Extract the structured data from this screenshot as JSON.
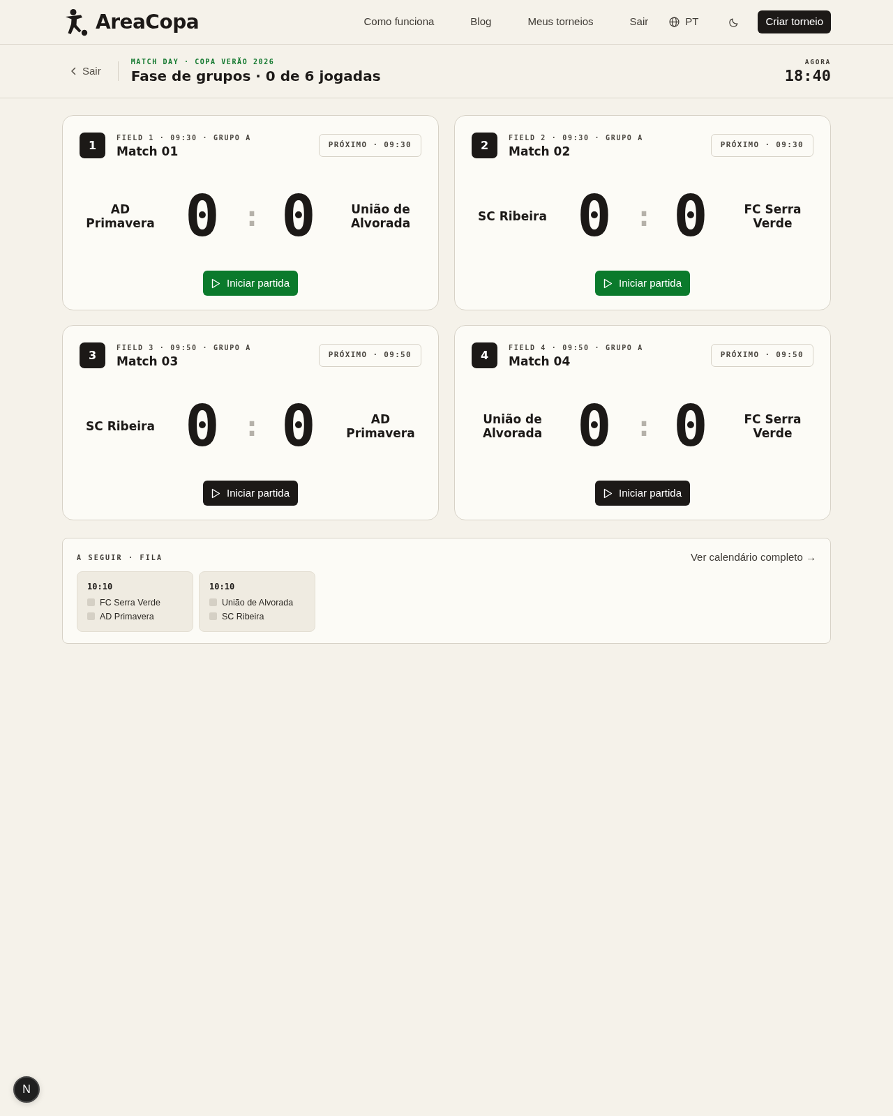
{
  "header": {
    "logo": "AreaCopa",
    "nav": [
      {
        "label": "Como funciona"
      },
      {
        "label": "Blog"
      },
      {
        "label": "Meus torneios"
      },
      {
        "label": "Sair"
      }
    ],
    "language": "PT",
    "cta": "Criar torneio"
  },
  "page_header": {
    "back": "Sair",
    "eyebrow": "MATCH DAY · COPA VERÃO 2026",
    "title": "Fase de grupos · 0 de 6 jogadas",
    "clock_label": "AGORA",
    "clock": "18:40"
  },
  "matches": [
    {
      "number": "1",
      "meta": "FIELD 1 · 09:30 · GRUPO A",
      "title": "Match 01",
      "status": "PRÓXIMO · 09:30",
      "home": "AD Primavera",
      "home_score": "0",
      "separator": ":",
      "away_score": "0",
      "away": "União de Alvorada",
      "button": {
        "label": "Iniciar partida",
        "highlighted": true
      }
    },
    {
      "number": "2",
      "meta": "FIELD 2 · 09:30 · GRUPO A",
      "title": "Match 02",
      "status": "PRÓXIMO · 09:30",
      "home": "SC Ribeira",
      "home_score": "0",
      "separator": ":",
      "away_score": "0",
      "away": "FC Serra Verde",
      "button": {
        "label": "Iniciar partida",
        "highlighted": true
      }
    },
    {
      "number": "3",
      "meta": "FIELD 3 · 09:50 · GRUPO A",
      "title": "Match 03",
      "status": "PRÓXIMO · 09:50",
      "home": "SC Ribeira",
      "home_score": "0",
      "separator": ":",
      "away_score": "0",
      "away": "AD Primavera",
      "button": {
        "label": "Iniciar partida",
        "highlighted": false
      }
    },
    {
      "number": "4",
      "meta": "FIELD 4 · 09:50 · GRUPO A",
      "title": "Match 04",
      "status": "PRÓXIMO · 09:50",
      "home": "União de Alvorada",
      "home_score": "0",
      "separator": ":",
      "away_score": "0",
      "away": "FC Serra Verde",
      "button": {
        "label": "Iniciar partida",
        "highlighted": false
      }
    }
  ],
  "queue": {
    "title": "A SEGUIR · FILA",
    "link": "Ver calendário completo →",
    "items": [
      {
        "time": "10:10",
        "teams": [
          "FC Serra Verde",
          "AD Primavera"
        ]
      },
      {
        "time": "10:10",
        "teams": [
          "União de Alvorada",
          "SC Ribeira"
        ]
      }
    ]
  },
  "dev_indicator": "N"
}
